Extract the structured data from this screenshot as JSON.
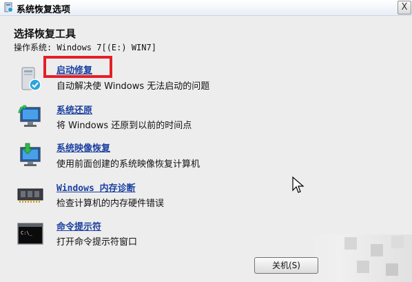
{
  "window": {
    "title": "系统恢复选项",
    "close_glyph": "X"
  },
  "main": {
    "heading": "选择恢复工具",
    "os_line": "操作系统: Windows 7[(E:) WIN7]"
  },
  "tools": [
    {
      "link": "启动修复",
      "desc": "自动解决使 Windows 无法启动的问题",
      "icon": "startup-repair-icon"
    },
    {
      "link": "系统还原",
      "desc": "将 Windows 还原到以前的时间点",
      "icon": "system-restore-icon"
    },
    {
      "link": "系统映像恢复",
      "desc": "使用前面创建的系统映像恢复计算机",
      "icon": "system-image-icon"
    },
    {
      "link": "Windows 内存诊断",
      "desc": "检查计算机的内存硬件错误",
      "icon": "memory-chip-icon"
    },
    {
      "link": "命令提示符",
      "desc": "打开命令提示符窗口",
      "icon": "command-prompt-icon"
    }
  ],
  "footer": {
    "shutdown_label": "关机(S)"
  },
  "colors": {
    "link": "#1a3fa0",
    "highlight": "#e41f26"
  }
}
